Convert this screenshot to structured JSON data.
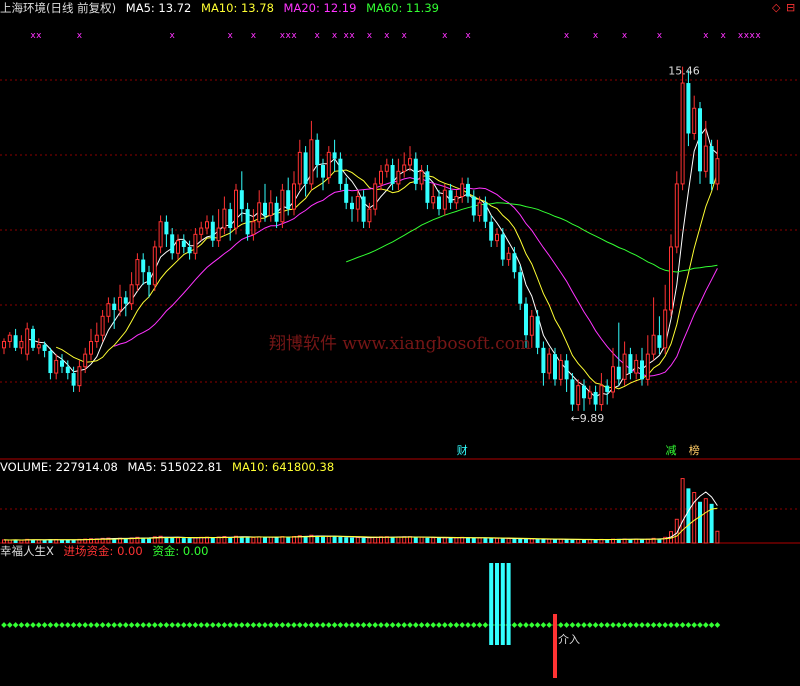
{
  "main_header": {
    "title": "上海环境(日线 前复权)",
    "ma": [
      {
        "label": "MA5: 13.72",
        "color": "#ffffff"
      },
      {
        "label": "MA10: 13.78",
        "color": "#ffff33"
      },
      {
        "label": "MA20: 12.19",
        "color": "#ff33ff"
      },
      {
        "label": "MA60: 11.39",
        "color": "#33ff33"
      }
    ]
  },
  "volume_header": {
    "items": [
      {
        "label": "VOLUME: 227914.08",
        "color": "#ffffff"
      },
      {
        "label": "MA5: 515022.81",
        "color": "#ffffff"
      },
      {
        "label": "MA10: 641800.38",
        "color": "#ffff33"
      }
    ]
  },
  "indicator_header": {
    "items": [
      {
        "label": "幸福人生X",
        "color": "#dddddd"
      },
      {
        "label": "进场资金: 0.00",
        "color": "#ff3333"
      },
      {
        "label": "资金: 0.00",
        "color": "#33ff33"
      }
    ]
  },
  "watermark": "翔博软件 www.xiangbosoft.com",
  "corner_icons": [
    "◇",
    "⊟"
  ],
  "colors": {
    "up": "#ff3333",
    "down": "#33ffff",
    "ma5": "#ffffff",
    "ma10": "#ffff33",
    "ma20": "#ff33ff",
    "ma60": "#33ff33",
    "grid": "#8b0000",
    "dot": "#33ff33",
    "marker": "#ff33ff"
  },
  "chart_data": [
    {
      "type": "candlestick",
      "name": "price",
      "ylim": [
        9.3,
        16.2
      ],
      "high_annotation": {
        "label": "15.46",
        "index": 121,
        "value": 15.46
      },
      "low_annotation": {
        "label": "←9.89",
        "index": 97,
        "value": 9.89
      },
      "event_labels": [
        {
          "label": "财",
          "index": 79,
          "color": "#33ffff"
        },
        {
          "label": "减",
          "index": 115,
          "color": "#33ff33"
        },
        {
          "label": "榜",
          "index": 119,
          "color": "#ffcc66"
        }
      ],
      "top_markers": {
        "symbol": "x",
        "indices": [
          5,
          6,
          13,
          29,
          39,
          43,
          48,
          49,
          50,
          54,
          57,
          59,
          60,
          63,
          66,
          69,
          76,
          80,
          97,
          102,
          107,
          113,
          121,
          124,
          127,
          128,
          129,
          130
        ]
      },
      "candles": [
        [
          11.0,
          11.1,
          11.15,
          10.9
        ],
        [
          11.1,
          11.2,
          11.25,
          11.0
        ],
        [
          11.2,
          11.0,
          11.3,
          10.95
        ],
        [
          11.0,
          11.1,
          11.2,
          10.9
        ],
        [
          10.9,
          11.3,
          11.4,
          10.8
        ],
        [
          11.3,
          11.0,
          11.35,
          10.95
        ],
        [
          11.0,
          11.05,
          11.15,
          10.9
        ],
        [
          11.05,
          10.95,
          11.1,
          10.85
        ],
        [
          10.95,
          10.6,
          11.0,
          10.5
        ],
        [
          10.6,
          10.8,
          10.9,
          10.5
        ],
        [
          10.8,
          10.7,
          10.9,
          10.6
        ],
        [
          10.7,
          10.6,
          10.8,
          10.5
        ],
        [
          10.6,
          10.4,
          10.7,
          10.3
        ],
        [
          10.4,
          10.7,
          10.8,
          10.3
        ],
        [
          10.7,
          10.9,
          11.0,
          10.6
        ],
        [
          10.9,
          11.1,
          11.3,
          10.8
        ],
        [
          11.1,
          11.2,
          11.4,
          11.0
        ],
        [
          11.2,
          11.5,
          11.6,
          11.1
        ],
        [
          11.5,
          11.7,
          11.8,
          11.4
        ],
        [
          11.7,
          11.6,
          11.8,
          11.3
        ],
        [
          11.6,
          11.8,
          12.0,
          11.5
        ],
        [
          11.8,
          11.7,
          11.9,
          11.5
        ],
        [
          11.7,
          12.0,
          12.2,
          11.6
        ],
        [
          12.0,
          12.4,
          12.5,
          11.9
        ],
        [
          12.4,
          12.2,
          12.5,
          12.0
        ],
        [
          12.2,
          12.0,
          12.3,
          11.8
        ],
        [
          12.0,
          12.6,
          12.7,
          11.9
        ],
        [
          12.6,
          13.0,
          13.1,
          12.5
        ],
        [
          13.0,
          12.8,
          13.1,
          12.6
        ],
        [
          12.8,
          12.5,
          12.9,
          12.4
        ],
        [
          12.5,
          12.7,
          12.8,
          12.4
        ],
        [
          12.7,
          12.6,
          12.8,
          12.5
        ],
        [
          12.6,
          12.5,
          12.7,
          12.4
        ],
        [
          12.5,
          12.8,
          12.9,
          12.4
        ],
        [
          12.8,
          12.9,
          13.0,
          12.7
        ],
        [
          12.9,
          13.0,
          13.1,
          12.8
        ],
        [
          13.0,
          12.7,
          13.1,
          12.6
        ],
        [
          12.7,
          12.9,
          13.2,
          12.6
        ],
        [
          12.9,
          13.2,
          13.4,
          12.8
        ],
        [
          13.2,
          12.9,
          13.3,
          12.7
        ],
        [
          12.9,
          13.5,
          13.6,
          12.8
        ],
        [
          13.5,
          13.2,
          13.8,
          13.0
        ],
        [
          13.2,
          12.8,
          13.3,
          12.7
        ],
        [
          12.8,
          13.0,
          13.2,
          12.7
        ],
        [
          13.0,
          13.3,
          13.5,
          12.9
        ],
        [
          13.3,
          13.1,
          13.6,
          13.0
        ],
        [
          13.1,
          13.3,
          13.5,
          13.0
        ],
        [
          13.3,
          13.0,
          13.4,
          12.9
        ],
        [
          13.0,
          13.5,
          13.6,
          12.9
        ],
        [
          13.5,
          13.2,
          13.7,
          13.1
        ],
        [
          13.2,
          13.6,
          13.8,
          13.1
        ],
        [
          13.6,
          14.1,
          14.3,
          13.5
        ],
        [
          14.1,
          13.6,
          14.2,
          13.4
        ],
        [
          13.6,
          14.3,
          14.6,
          13.5
        ],
        [
          14.3,
          13.9,
          14.4,
          13.7
        ],
        [
          13.9,
          13.7,
          14.0,
          13.5
        ],
        [
          13.7,
          14.1,
          14.2,
          13.6
        ],
        [
          14.1,
          14.0,
          14.3,
          13.8
        ],
        [
          14.0,
          13.6,
          14.1,
          13.5
        ],
        [
          13.6,
          13.3,
          13.7,
          13.2
        ],
        [
          13.3,
          13.2,
          13.4,
          13.0
        ],
        [
          13.2,
          13.4,
          13.5,
          13.0
        ],
        [
          13.4,
          13.0,
          13.5,
          12.9
        ],
        [
          13.0,
          13.2,
          13.3,
          12.9
        ],
        [
          13.2,
          13.6,
          13.7,
          13.1
        ],
        [
          13.6,
          13.8,
          13.9,
          13.5
        ],
        [
          13.8,
          13.9,
          14.0,
          13.7
        ],
        [
          13.9,
          13.6,
          14.0,
          13.5
        ],
        [
          13.6,
          13.8,
          14.0,
          13.5
        ],
        [
          13.8,
          13.9,
          14.1,
          13.7
        ],
        [
          13.9,
          14.0,
          14.2,
          13.8
        ],
        [
          14.0,
          13.6,
          14.1,
          13.5
        ],
        [
          13.6,
          13.8,
          13.9,
          13.5
        ],
        [
          13.8,
          13.3,
          13.9,
          13.2
        ],
        [
          13.3,
          13.4,
          13.6,
          13.2
        ],
        [
          13.4,
          13.2,
          13.5,
          13.1
        ],
        [
          13.2,
          13.5,
          13.6,
          13.1
        ],
        [
          13.5,
          13.3,
          13.6,
          13.2
        ],
        [
          13.3,
          13.4,
          13.5,
          13.2
        ],
        [
          13.4,
          13.6,
          13.7,
          13.3
        ],
        [
          13.6,
          13.4,
          13.7,
          13.3
        ],
        [
          13.4,
          13.1,
          13.5,
          13.0
        ],
        [
          13.1,
          13.3,
          13.4,
          13.0
        ],
        [
          13.3,
          13.0,
          13.4,
          12.9
        ],
        [
          13.0,
          12.7,
          13.1,
          12.6
        ],
        [
          12.7,
          12.8,
          12.9,
          12.6
        ],
        [
          12.8,
          12.4,
          12.9,
          12.3
        ],
        [
          12.4,
          12.5,
          12.6,
          12.3
        ],
        [
          12.5,
          12.2,
          12.6,
          12.1
        ],
        [
          12.2,
          11.7,
          12.3,
          11.6
        ],
        [
          11.7,
          11.2,
          11.8,
          11.0
        ],
        [
          11.2,
          11.5,
          11.6,
          11.0
        ],
        [
          11.5,
          11.0,
          11.6,
          10.9
        ],
        [
          11.0,
          10.6,
          11.1,
          10.4
        ],
        [
          10.6,
          10.9,
          11.0,
          10.5
        ],
        [
          10.9,
          10.5,
          11.0,
          10.4
        ],
        [
          10.5,
          10.8,
          10.9,
          10.4
        ],
        [
          10.8,
          10.5,
          10.9,
          10.3
        ],
        [
          10.5,
          10.1,
          10.6,
          10.0
        ],
        [
          10.1,
          10.4,
          10.5,
          10.0
        ],
        [
          10.4,
          10.2,
          10.5,
          10.0
        ],
        [
          10.2,
          10.3,
          10.4,
          10.1
        ],
        [
          10.3,
          10.1,
          10.4,
          10.0
        ],
        [
          10.1,
          10.4,
          10.6,
          10.0
        ],
        [
          10.4,
          10.3,
          10.5,
          10.1
        ],
        [
          10.3,
          10.7,
          11.0,
          10.2
        ],
        [
          10.7,
          10.5,
          11.4,
          10.4
        ],
        [
          10.5,
          10.9,
          11.1,
          10.4
        ],
        [
          10.9,
          10.6,
          11.0,
          10.5
        ],
        [
          10.6,
          10.8,
          10.9,
          10.5
        ],
        [
          10.8,
          10.5,
          11.0,
          10.4
        ],
        [
          10.5,
          10.9,
          11.2,
          10.4
        ],
        [
          10.9,
          11.2,
          11.8,
          10.8
        ],
        [
          11.2,
          11.0,
          11.5,
          10.9
        ],
        [
          11.0,
          11.6,
          12.0,
          10.9
        ],
        [
          11.6,
          12.6,
          12.8,
          11.5
        ],
        [
          12.6,
          13.6,
          13.8,
          12.5
        ],
        [
          13.6,
          15.2,
          15.46,
          13.5
        ],
        [
          15.2,
          14.4,
          15.4,
          14.2
        ],
        [
          14.4,
          14.8,
          15.0,
          14.3
        ],
        [
          14.8,
          13.8,
          14.9,
          13.6
        ],
        [
          13.8,
          14.2,
          14.6,
          13.7
        ],
        [
          14.2,
          13.6,
          14.3,
          13.5
        ],
        [
          13.6,
          14.0,
          14.3,
          13.5
        ]
      ]
    },
    {
      "type": "bar",
      "name": "volume",
      "ylim": [
        0,
        1300000
      ],
      "values": [
        60000,
        58000,
        62000,
        55000,
        70000,
        65000,
        58000,
        60000,
        72000,
        68000,
        60000,
        58000,
        64000,
        70000,
        75000,
        82000,
        80000,
        90000,
        95000,
        88000,
        92000,
        86000,
        98000,
        110000,
        102000,
        95000,
        120000,
        130000,
        118000,
        104000,
        100000,
        96000,
        94000,
        105000,
        110000,
        112000,
        100000,
        115000,
        125000,
        112000,
        130000,
        125000,
        110000,
        108000,
        118000,
        114000,
        116000,
        108000,
        124000,
        120000,
        126000,
        140000,
        128000,
        150000,
        136000,
        124000,
        130000,
        128000,
        118000,
        110000,
        104000,
        108000,
        100000,
        104000,
        114000,
        120000,
        122000,
        112000,
        118000,
        120000,
        122000,
        108000,
        112000,
        100000,
        102000,
        98000,
        106000,
        100000,
        102000,
        110000,
        104000,
        96000,
        100000,
        94000,
        90000,
        92000,
        86000,
        88000,
        84000,
        80000,
        76000,
        80000,
        74000,
        70000,
        74000,
        70000,
        72000,
        68000,
        64000,
        68000,
        66000,
        68000,
        64000,
        70000,
        66000,
        74000,
        80000,
        76000,
        72000,
        74000,
        70000,
        76000,
        90000,
        84000,
        110000,
        220000,
        460000,
        1250000,
        1060000,
        980000,
        800000,
        860000,
        760000,
        227914.08
      ],
      "ma5": [
        515022.81
      ],
      "ma10": [
        641800.38
      ]
    },
    {
      "type": "bar",
      "name": "indicator",
      "series": [
        {
          "name": "进场资金",
          "indices": [
            95
          ],
          "values": [
            1
          ]
        },
        {
          "name": "资金",
          "indices": [
            84,
            85,
            86,
            87
          ],
          "values": [
            1,
            1,
            1,
            1
          ]
        }
      ],
      "annotation": {
        "label": "介入",
        "index": 95
      }
    }
  ]
}
